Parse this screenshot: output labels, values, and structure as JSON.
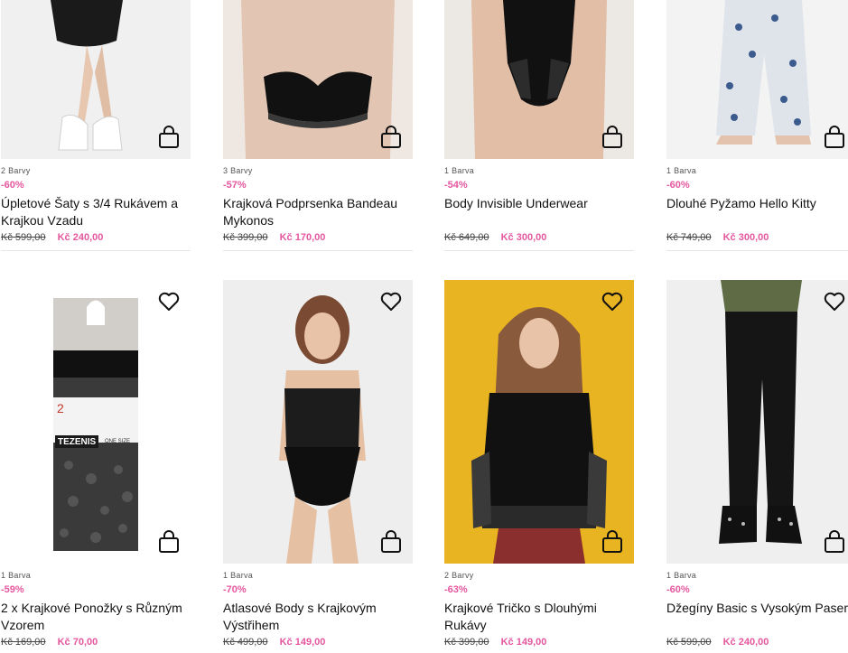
{
  "products": [
    {
      "colors": "2 Barvy",
      "discount": "-60%",
      "name": "Úpletové Šaty s 3/4 Rukávem a Krajkou Vzadu",
      "old_price": "Kč 599,00",
      "new_price": "Kč 240,00",
      "bg": "#f0f0f0"
    },
    {
      "colors": "3 Barvy",
      "discount": "-57%",
      "name": "Krajková Podprsenka Bandeau Mykonos",
      "old_price": "Kč 399,00",
      "new_price": "Kč 170,00",
      "bg": "#eaeaea"
    },
    {
      "colors": "1 Barva",
      "discount": "-54%",
      "name": "Body Invisible Underwear",
      "old_price": "Kč 649,00",
      "new_price": "Kč 300,00",
      "bg": "#ece8e4"
    },
    {
      "colors": "1 Barva",
      "discount": "-60%",
      "name": "Dlouhé Pyžamo Hello Kitty",
      "old_price": "Kč 749,00",
      "new_price": "Kč 300,00",
      "bg": "#f3f3f3"
    },
    {
      "colors": "1 Barva",
      "discount": "-59%",
      "name": "2 x Krajkové Ponožky s Různým Vzorem",
      "old_price": "Kč 169,00",
      "new_price": "Kč 70,00",
      "bg": "#ffffff"
    },
    {
      "colors": "1 Barva",
      "discount": "-70%",
      "name": "Atlasové Body s Krajkovým Výstřihem",
      "old_price": "Kč 499,00",
      "new_price": "Kč 149,00",
      "bg": "#eeeeee"
    },
    {
      "colors": "2 Barvy",
      "discount": "-63%",
      "name": "Krajkové Tričko s Dlouhými Rukávy",
      "old_price": "Kč 399,00",
      "new_price": "Kč 149,00",
      "bg": "#e9b422"
    },
    {
      "colors": "1 Barva",
      "discount": "-60%",
      "name": "Džegíny Basic s Vysokým Pasem",
      "old_price": "Kč 599,00",
      "new_price": "Kč 240,00",
      "bg": "#efefef"
    }
  ],
  "packaging": {
    "count": "2",
    "brand": "TEZENIS",
    "size": "ONE SIZE"
  },
  "icons": {
    "bag": "shopping-bag-icon",
    "heart": "heart-icon"
  }
}
